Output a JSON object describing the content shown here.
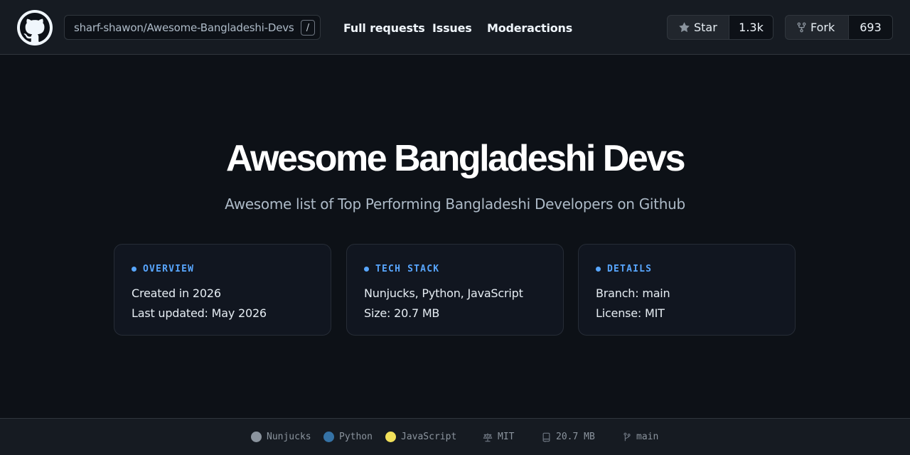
{
  "header": {
    "repo": "sharf-shawon/Awesome-Bangladeshi-Devs",
    "search_key": "/",
    "nav": [
      "Full requests",
      "Issues",
      "Moderactions"
    ],
    "star": {
      "label": "Star",
      "count": "1.3k"
    },
    "fork": {
      "label": "Fork",
      "count": "693"
    }
  },
  "hero": {
    "title": "Awesome Bangladeshi Devs",
    "subtitle": "Awesome list of Top Performing Bangladeshi Developers on Github"
  },
  "cards": [
    {
      "label": "OVERVIEW",
      "lines": [
        "Created in 2026",
        "Last updated: May 2026"
      ]
    },
    {
      "label": "TECH STACK",
      "lines": [
        "Nunjucks, Python, JavaScript",
        "Size: 20.7 MB"
      ]
    },
    {
      "label": "DETAILS",
      "lines": [
        "Branch: main",
        "License: MIT"
      ]
    }
  ],
  "footer": {
    "languages": [
      {
        "name": "Nunjucks",
        "color": "#8b949e"
      },
      {
        "name": "Python",
        "color": "#3572a5"
      },
      {
        "name": "JavaScript",
        "color": "#f1e05a"
      }
    ],
    "license": "MIT",
    "size": "20.7 MB",
    "branch": "main"
  },
  "colors": {
    "accent": "#58a6ff",
    "background": "#0d1117",
    "surface": "#161b22"
  }
}
